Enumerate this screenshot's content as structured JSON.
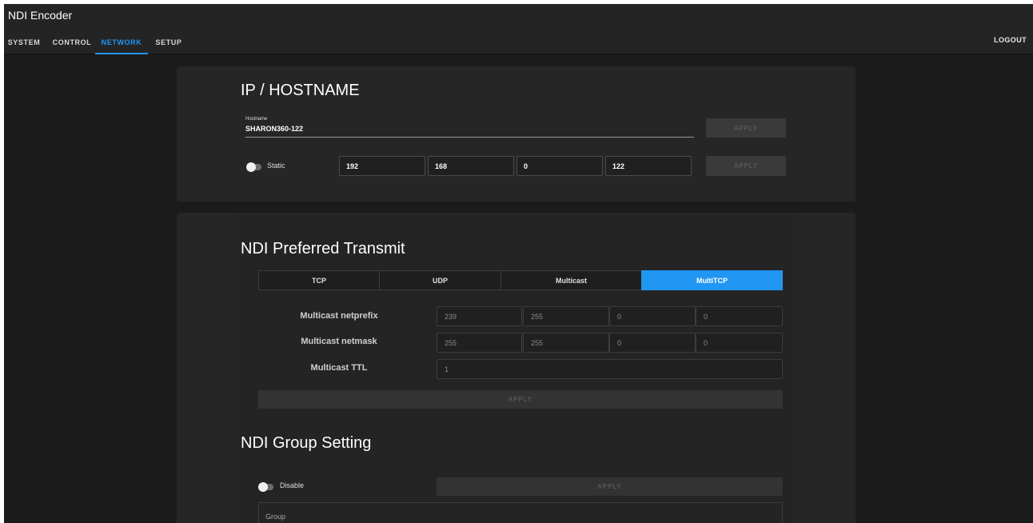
{
  "header": {
    "title": "NDI Encoder",
    "tabs": [
      {
        "label": "SYSTEM",
        "active": false
      },
      {
        "label": "CONTROL",
        "active": false
      },
      {
        "label": "NETWORK",
        "active": true
      },
      {
        "label": "SETUP",
        "active": false
      }
    ],
    "logout_label": "LOGOUT"
  },
  "ip_section": {
    "title": "IP / HOSTNAME",
    "hostname_label": "Hostname",
    "hostname_value": "SHARON360-122",
    "apply_label": "APPLY",
    "static_label": "Static",
    "static_enabled": false,
    "ip_octets": [
      "192",
      "168",
      "0",
      "122"
    ]
  },
  "ndi_transmit": {
    "title": "NDI Preferred Transmit",
    "tabs": [
      {
        "label": "TCP",
        "active": false
      },
      {
        "label": "UDP",
        "active": false
      },
      {
        "label": "Multicast",
        "active": false
      },
      {
        "label": "MultiTCP",
        "active": true
      }
    ],
    "netprefix_label": "Multicast netprefix",
    "netprefix": [
      "239",
      "255",
      "0",
      "0"
    ],
    "netmask_label": "Multicast netmask",
    "netmask": [
      "255",
      "255",
      "0",
      "0"
    ],
    "ttl_label": "Multicast TTL",
    "ttl": "1",
    "apply_label": "APPLY"
  },
  "ndi_group": {
    "title": "NDI Group Setting",
    "toggle_label": "Disable",
    "enabled": false,
    "apply_label": "APPLY",
    "group_label": "Group"
  },
  "colors": {
    "accent": "#2196f3",
    "background": "#1b1b1b",
    "card": "#262626"
  }
}
